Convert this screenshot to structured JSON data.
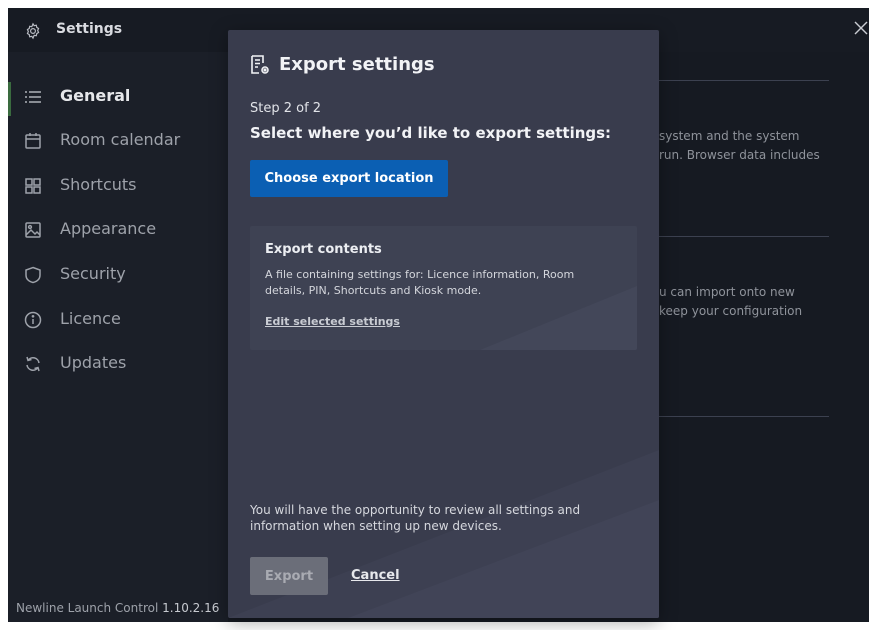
{
  "window": {
    "title": "Settings"
  },
  "sidebar": {
    "items": [
      {
        "label": "General",
        "icon": "list-icon",
        "active": true
      },
      {
        "label": "Room calendar",
        "icon": "calendar-icon"
      },
      {
        "label": "Shortcuts",
        "icon": "grid-icon"
      },
      {
        "label": "Appearance",
        "icon": "image-icon"
      },
      {
        "label": "Security",
        "icon": "shield-icon"
      },
      {
        "label": "Licence",
        "icon": "info-icon"
      },
      {
        "label": "Updates",
        "icon": "refresh-icon"
      }
    ],
    "version_label": "Newline Launch Control",
    "version_number": "1.10.2.16"
  },
  "background": {
    "text1_line1": "system and the system",
    "text1_line2": "run. Browser data includes",
    "text2_line1": "u can import onto new",
    "text2_line2": "keep your configuration"
  },
  "dialog": {
    "title": "Export settings",
    "step": "Step 2 of 2",
    "question": "Select where you’d like to export settings:",
    "choose_button": "Choose export location",
    "card": {
      "title": "Export contents",
      "description": "A file containing settings for: Licence information, Room details, PIN, Shortcuts and Kiosk mode.",
      "link": "Edit selected settings"
    },
    "footnote": "You will have the opportunity to review all settings and information when setting up new devices.",
    "export_button": "Export",
    "cancel_button": "Cancel"
  },
  "colors": {
    "accent": "#0b5fb3",
    "dialog_bg": "#393c4d",
    "app_bg": "#161a22"
  }
}
